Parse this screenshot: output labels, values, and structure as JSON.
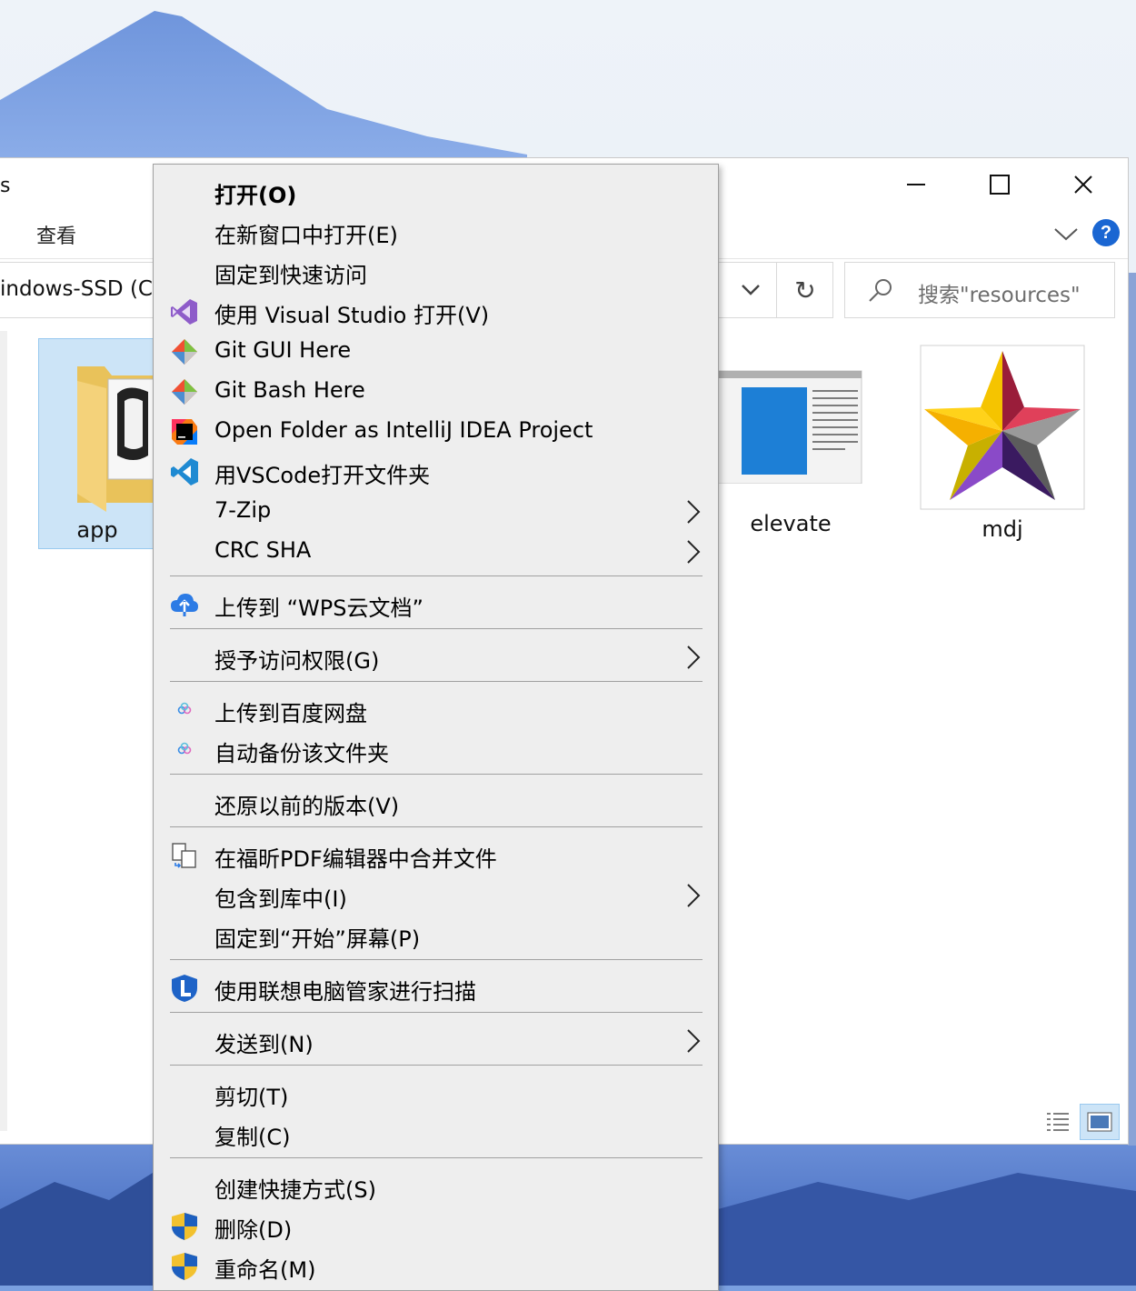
{
  "explorer": {
    "title_fragment": "s",
    "ribbon_tab_view": "查看",
    "address_fragment": "indows-SSD (C",
    "search_placeholder": "搜索\"resources\"",
    "items": [
      {
        "name": "app"
      },
      {
        "name": "elevate"
      },
      {
        "name": "mdj"
      }
    ]
  },
  "context_menu": {
    "open": "打开(O)",
    "open_new_window": "在新窗口中打开(E)",
    "pin_quick_access": "固定到快速访问",
    "open_visual_studio": "使用 Visual Studio 打开(V)",
    "git_gui": "Git GUI Here",
    "git_bash": "Git Bash Here",
    "open_intellij": "Open Folder as IntelliJ IDEA Project",
    "open_vscode": "用VSCode打开文件夹",
    "seven_zip": "7-Zip",
    "crc_sha": "CRC SHA",
    "upload_wps": "上传到 “WPS云文档”",
    "grant_access": "授予访问权限(G)",
    "upload_baidu": "上传到百度网盘",
    "auto_backup": "自动备份该文件夹",
    "restore_versions": "还原以前的版本(V)",
    "foxit_merge": "在福昕PDF编辑器中合并文件",
    "include_library": "包含到库中(I)",
    "pin_start": "固定到“开始”屏幕(P)",
    "lenovo_scan": "使用联想电脑管家进行扫描",
    "send_to": "发送到(N)",
    "cut": "剪切(T)",
    "copy": "复制(C)",
    "create_shortcut": "创建快捷方式(S)",
    "delete": "删除(D)",
    "rename": "重命名(M)"
  },
  "colors": {
    "selection": "#cce4f7",
    "menu_bg": "#eeeeee",
    "accent": "#1a66d2"
  }
}
